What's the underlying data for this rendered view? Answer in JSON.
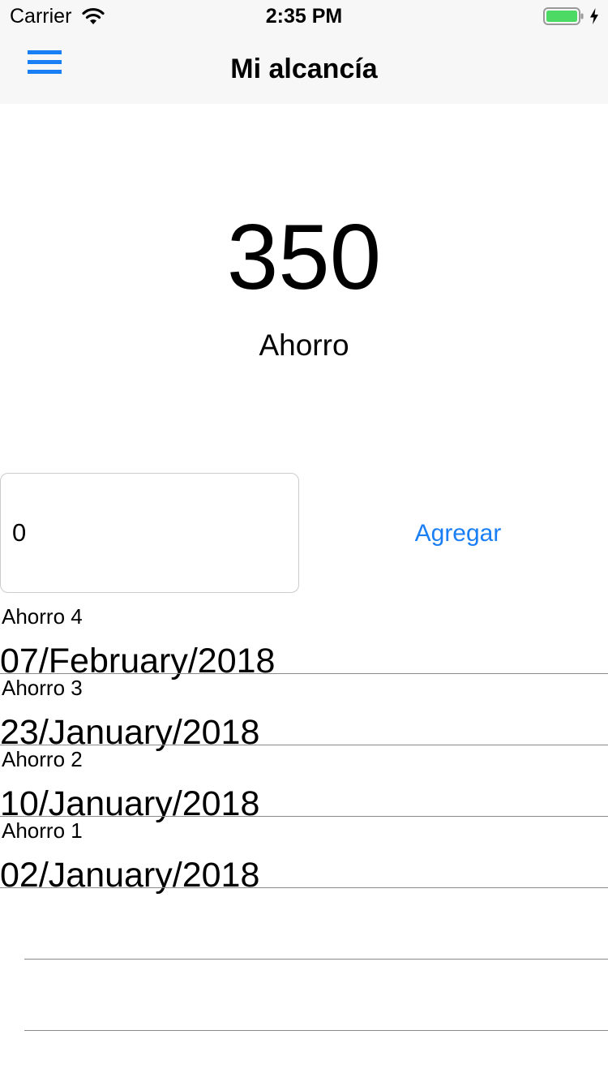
{
  "status_bar": {
    "carrier": "Carrier",
    "time": "2:35 PM",
    "battery_color": "#4cd964"
  },
  "nav": {
    "title": "Mi alcancía",
    "menu_icon": "hamburger-menu-icon",
    "accent_color": "#1a7ff4"
  },
  "summary": {
    "total": "350",
    "label": "Ahorro"
  },
  "add_form": {
    "amount_value": "0",
    "add_label": "Agregar"
  },
  "savings": [
    {
      "name": "Ahorro 4",
      "date": "07/February/2018"
    },
    {
      "name": "Ahorro 3",
      "date": "23/January/2018"
    },
    {
      "name": "Ahorro 2",
      "date": "10/January/2018"
    },
    {
      "name": "Ahorro 1",
      "date": "02/January/2018"
    }
  ]
}
